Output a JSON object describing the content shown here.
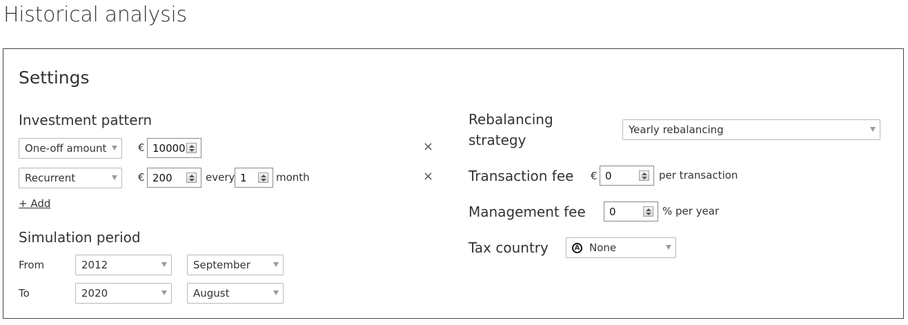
{
  "page": {
    "title": "Historical analysis"
  },
  "settings": {
    "title": "Settings",
    "investment_pattern": {
      "title": "Investment pattern",
      "rows": [
        {
          "type": "One-off amount",
          "currency": "€",
          "amount": "10000"
        },
        {
          "type": "Recurrent",
          "currency": "€",
          "amount": "200",
          "every_label": "every",
          "interval": "1",
          "unit": "month"
        }
      ],
      "remove_icon": "close-icon",
      "add_label": "+ Add"
    },
    "simulation_period": {
      "title": "Simulation period",
      "from_label": "From",
      "from_year": "2012",
      "from_month": "September",
      "to_label": "To",
      "to_year": "2020",
      "to_month": "August"
    },
    "rebalancing": {
      "label_line1": "Rebalancing",
      "label_line2": "strategy",
      "value": "Yearly rebalancing"
    },
    "transaction_fee": {
      "label": "Transaction fee",
      "currency": "€",
      "value": "0",
      "suffix": "per transaction"
    },
    "management_fee": {
      "label": "Management fee",
      "value": "0",
      "suffix": "% per year"
    },
    "tax_country": {
      "label": "Tax country",
      "icon": "anarchy-icon",
      "value": "None"
    }
  }
}
